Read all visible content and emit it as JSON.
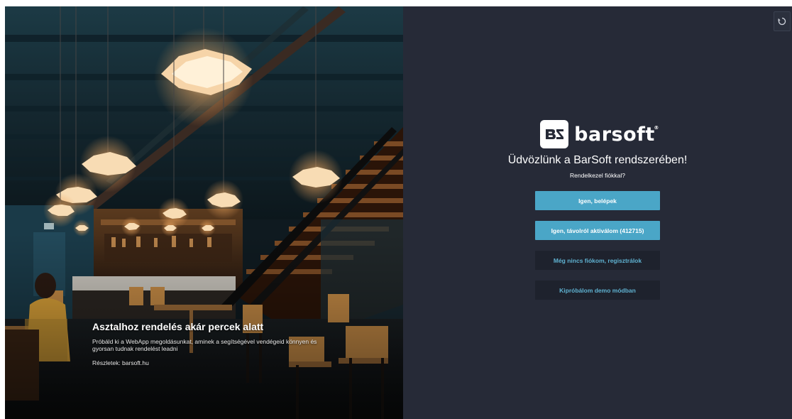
{
  "hero": {
    "title": "Asztalhoz rendelés akár percek alatt",
    "description": "Próbáld ki a WebApp megoldásunkat, aminek a segítségével vendégeid könnyen és gyorsan tudnak rendelést leadni",
    "details_link": "Részletek: barsoft.hu"
  },
  "login": {
    "brand": "barsoft",
    "welcome": "Üdvözlünk a BarSoft rendszerében!",
    "question": "Rendelkezel fiókkal?",
    "buttons": {
      "login": "Igen, belépek",
      "remote_activate": "Igen, távolról aktiválom (412715)",
      "register": "Még nincs fiókom, regisztrálok",
      "demo": "Kipróbálom demo módban"
    }
  },
  "colors": {
    "panel_bg": "#262a37",
    "accent": "#4aa6c7",
    "dark_button": "#1e222d"
  },
  "icons": {
    "refresh": "refresh-icon",
    "logo": "barsoft-logo-icon"
  }
}
